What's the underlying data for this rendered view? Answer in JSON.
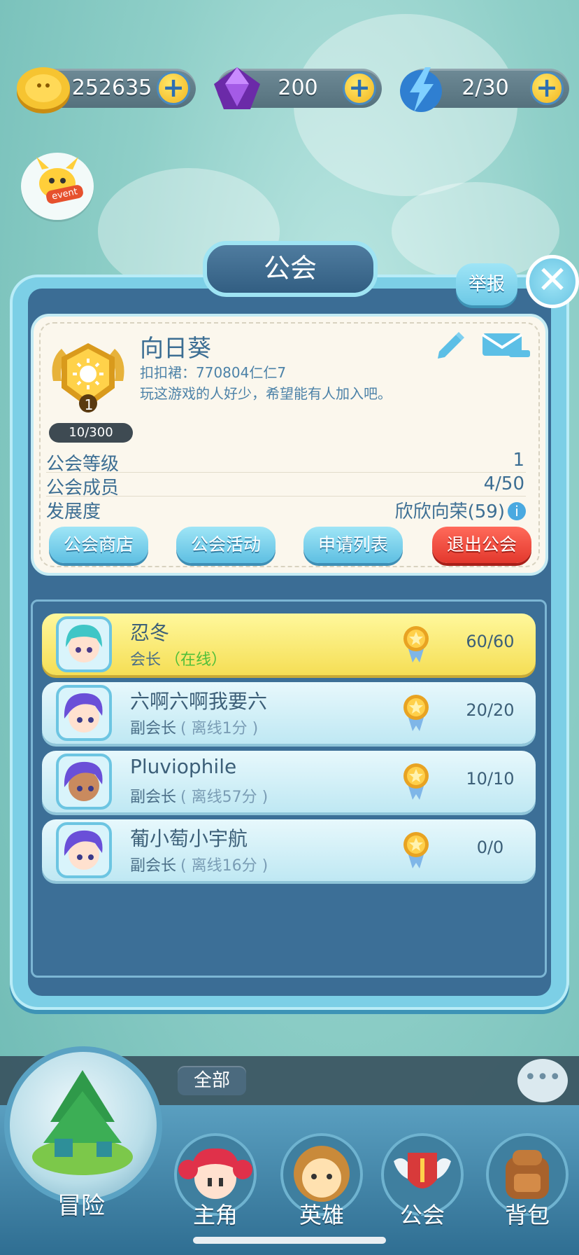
{
  "resources": {
    "coins": "252635",
    "gems": "200",
    "energy": "2/30"
  },
  "event_label": "event",
  "panel": {
    "title": "公会",
    "report_label": "举报",
    "close_label": "✕"
  },
  "guild": {
    "name": "向日葵",
    "contact": "扣扣裙：770804仁仁7",
    "motto": "玩这游戏的人好少，希望能有人加入吧。",
    "badge_level": "1",
    "progress": "10/300",
    "stats": [
      {
        "label": "公会等级",
        "value": "1"
      },
      {
        "label": "公会成员",
        "value": "4/50"
      },
      {
        "label": "发展度",
        "value": "欣欣向荣(59)"
      }
    ]
  },
  "actions": {
    "shop": "公会商店",
    "activity": "公会活动",
    "requests": "申请列表",
    "leave": "退出公会"
  },
  "members": [
    {
      "name": "忍冬",
      "role": "会长",
      "status": "（在线）",
      "score": "60/60"
    },
    {
      "name": "六啊六啊我要六",
      "role": "副会长",
      "status": "( 离线1分 )",
      "score": "20/20"
    },
    {
      "name": "Pluviophile",
      "role": "副会长",
      "status": "( 离线57分 )",
      "score": "10/10"
    },
    {
      "name": "葡小萄小宇航",
      "role": "副会长",
      "status": "( 离线16分 )",
      "score": "0/0"
    }
  ],
  "chat": {
    "filter": "全部"
  },
  "nav": {
    "adventure": "冒险",
    "hero_main": "主角",
    "heroes": "英雄",
    "guild": "公会",
    "bag": "背包"
  },
  "colors": {
    "panel_border": "#7ccfe6",
    "panel_inner": "#3b6d95",
    "leader_row": "#f5de55",
    "leave_button": "#e3382d",
    "online": "#4fbf3a"
  }
}
